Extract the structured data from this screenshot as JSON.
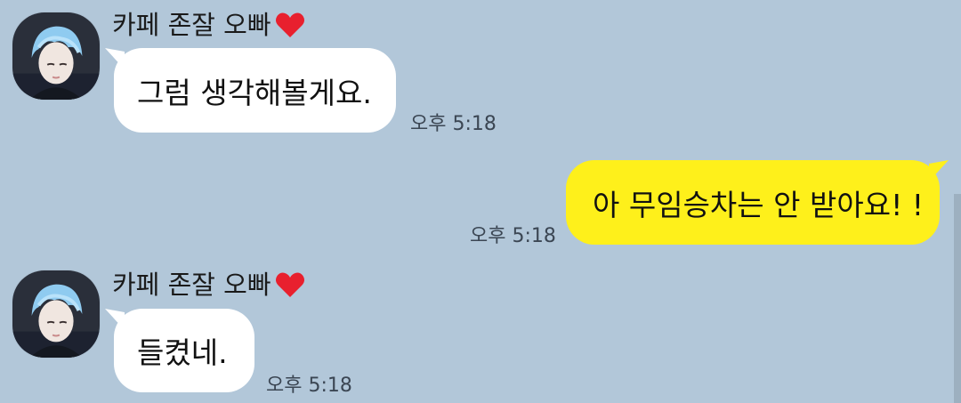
{
  "theme": {
    "background": "#b2c7d9",
    "incoming_bubble": "#ffffff",
    "outgoing_bubble": "#fef01b",
    "heart_color": "#e8202e"
  },
  "messages": [
    {
      "direction": "incoming",
      "sender_name": "카페 존잘 오빠",
      "sender_emoji": "heart-icon",
      "text": "그럼 생각해볼게요.",
      "time": "오후 5:18"
    },
    {
      "direction": "outgoing",
      "text": "아 무임승차는 안 받아요! !",
      "time": "오후 5:18"
    },
    {
      "direction": "incoming",
      "sender_name": "카페 존잘 오빠",
      "sender_emoji": "heart-icon",
      "text": "들켰네.",
      "time": "오후 5:18"
    }
  ]
}
